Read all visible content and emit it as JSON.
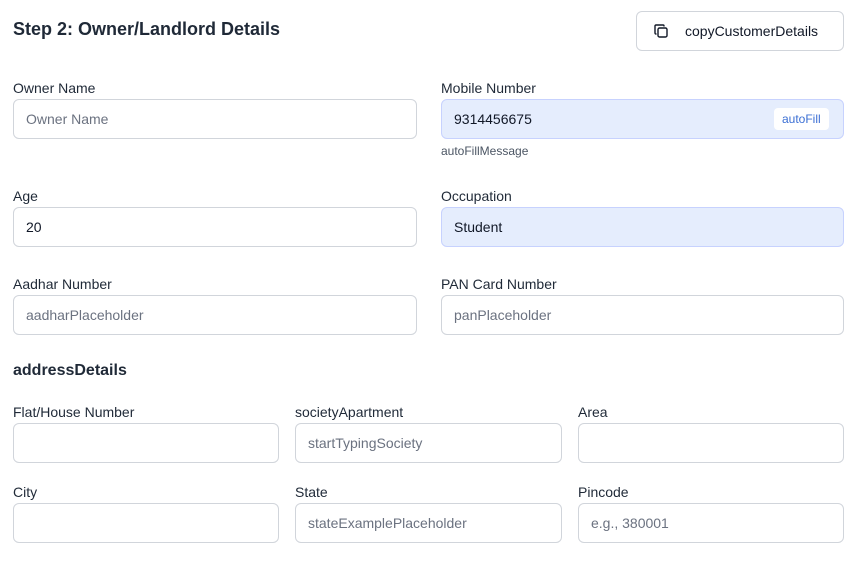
{
  "header": {
    "title": "Step 2: Owner/Landlord Details",
    "copy_button_label": "copyCustomerDetails",
    "copy_icon": "copy-icon"
  },
  "owner": {
    "owner_name": {
      "label": "Owner Name",
      "value": "",
      "placeholder": "Owner Name"
    },
    "mobile": {
      "label": "Mobile Number",
      "value": "9314456675",
      "placeholder": "",
      "badge": "autoFill",
      "hint": "autoFillMessage"
    },
    "age": {
      "label": "Age",
      "value": "20",
      "placeholder": ""
    },
    "occupation": {
      "label": "Occupation",
      "value": "Student",
      "placeholder": ""
    },
    "aadhar": {
      "label": "Aadhar Number",
      "value": "",
      "placeholder": "aadharPlaceholder"
    },
    "pan": {
      "label": "PAN Card Number",
      "value": "",
      "placeholder": "panPlaceholder"
    }
  },
  "address": {
    "section_title": "addressDetails",
    "flat": {
      "label": "Flat/House Number",
      "value": "",
      "placeholder": ""
    },
    "society": {
      "label": "societyApartment",
      "value": "",
      "placeholder": "startTypingSociety"
    },
    "area": {
      "label": "Area",
      "value": "",
      "placeholder": ""
    },
    "city": {
      "label": "City",
      "value": "",
      "placeholder": ""
    },
    "state": {
      "label": "State",
      "value": "",
      "placeholder": "stateExamplePlaceholder"
    },
    "pincode": {
      "label": "Pincode",
      "value": "",
      "placeholder": "e.g., 380001"
    }
  },
  "colors": {
    "autofill_background": "#e5edfd",
    "accent": "#3b6fd4",
    "border": "#d1d5db"
  }
}
